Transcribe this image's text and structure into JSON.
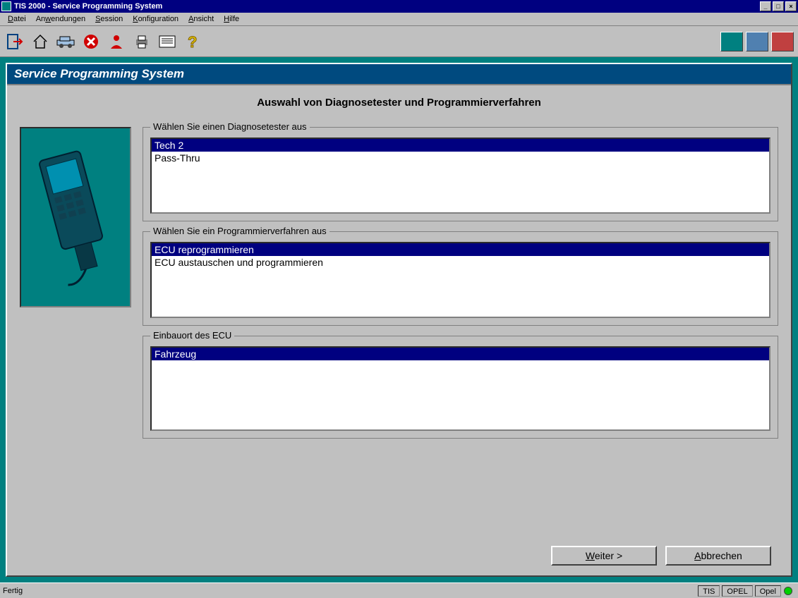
{
  "window": {
    "app": "TIS 2000",
    "title": "Service Programming System"
  },
  "menu": {
    "datei": "Datei",
    "anwendungen": "Anwendungen",
    "session": "Session",
    "konfiguration": "Konfiguration",
    "ansicht": "Ansicht",
    "hilfe": "Hilfe"
  },
  "panel": {
    "title": "Service Programming System",
    "heading": "Auswahl von Diagnosetester und Programmierverfahren"
  },
  "groups": {
    "tester": {
      "legend": "Wählen Sie einen Diagnosetester aus",
      "options": [
        "Tech 2",
        "Pass-Thru"
      ],
      "selected": 0
    },
    "method": {
      "legend": "Wählen Sie ein Programmierverfahren aus",
      "options": [
        "ECU reprogrammieren",
        "ECU austauschen und programmieren"
      ],
      "selected": 0
    },
    "location": {
      "legend": "Einbauort des ECU",
      "options": [
        "Fahrzeug"
      ],
      "selected": 0
    }
  },
  "buttons": {
    "next": "Weiter >",
    "cancel": "Abbrechen"
  },
  "status": {
    "left": "Fertig",
    "f1": "TIS",
    "f2": "OPEL",
    "f3": "Opel"
  }
}
